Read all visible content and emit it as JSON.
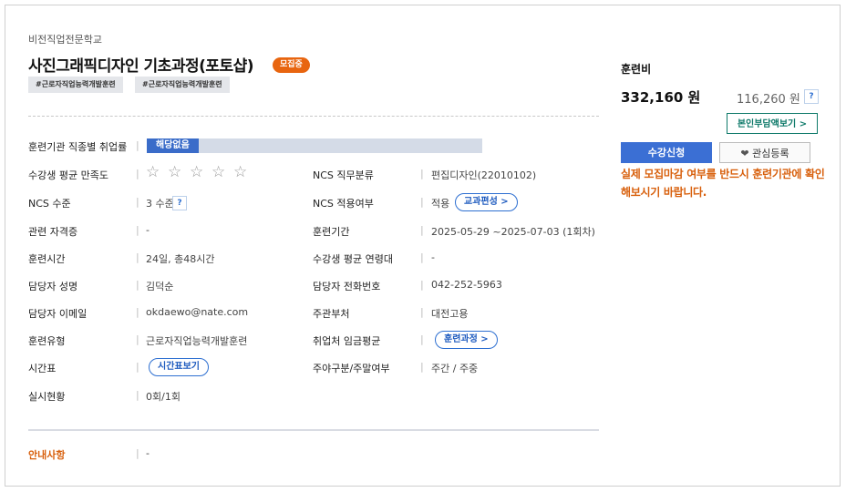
{
  "course": {
    "school": "비전직업전문학교",
    "title": "사진그래픽디자인 기초과정(포토샵)",
    "status_badge": "모집중",
    "tags": [
      "#근로자직업능력개발훈련",
      "#근로자직업능력개발훈련"
    ]
  },
  "info": {
    "employment_rate_label": "훈련기관 직종별 취업률",
    "employment_rate_value": "해당없음",
    "satisfaction_label": "수강생 평균 만족도",
    "satisfaction_stars": 0,
    "satisfaction_max": 5,
    "ncs_category_label": "NCS 직무분류",
    "ncs_category_value": "편집디자인(22010102)",
    "ncs_level_label": "NCS 수준",
    "ncs_level_value": "3 수준",
    "ncs_applied_label": "NCS 적용여부",
    "ncs_applied_value": "적용",
    "curriculum_button": "교과편성 >",
    "cert_label": "관련 자격증",
    "cert_value": "-",
    "period_label": "훈련기간",
    "period_value": "2025-05-29 ~2025-07-03 (1회차)",
    "hours_label": "훈련시간",
    "hours_value": "24일, 총48시간",
    "age_label": "수강생 평균 연령대",
    "age_value": "-",
    "contact_name_label": "담당자 성명",
    "contact_name_value": "김덕순",
    "phone_label": "담당자 전화번호",
    "phone_value": "042-252-5963",
    "email_label": "담당자 이메일",
    "email_value": "okdaewo@nate.com",
    "ministry_label": "주관부처",
    "ministry_value": "대전고용",
    "type_label": "훈련유형",
    "type_value": "근로자직업능력개발훈련",
    "wage_label": "취업처 임금평균",
    "training_button": "훈련과정 >",
    "schedule_label": "시간표",
    "schedule_button": "시간표보기",
    "daynight_label": "주야구분/주말여부",
    "daynight_value": "주간 / 주중",
    "enroll_label": "실시현황",
    "enroll_value": "0회/1회",
    "notice_label": "안내사항",
    "notice_value": "-",
    "help_glyph": "?"
  },
  "fee": {
    "label": "훈련비",
    "amount": "332,160 원",
    "self_pay": "116,260 원",
    "self_pay_button": "본인부담액보기 >",
    "apply_button": "수강신청",
    "favorite_button": "관심등록",
    "warning": "실제 모집마감 여부를 반드시 훈련기관에 확인해보시기 바랍니다."
  },
  "colors": {
    "accent_blue": "#3b6fd4",
    "accent_orange": "#e8650f",
    "accent_teal": "#0f7a6a"
  }
}
